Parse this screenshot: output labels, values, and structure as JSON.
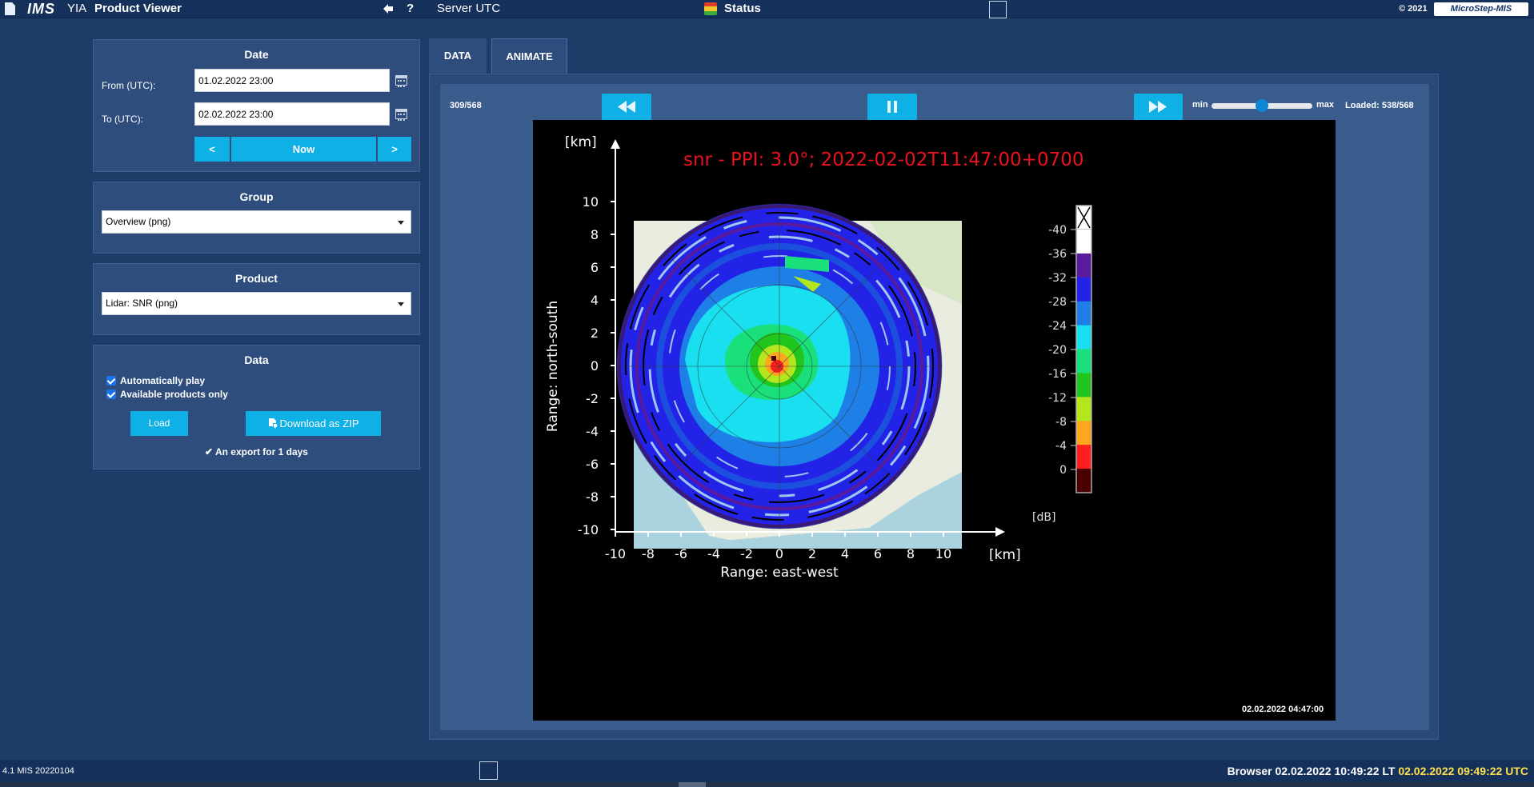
{
  "topbar": {
    "logo": "IMS",
    "ims_sub": "YIA",
    "title": "Product Viewer",
    "help": "?",
    "server_label": "Server UTC",
    "status_label": "Status",
    "copyright": "© 2021",
    "brand": "MicroStep-MIS"
  },
  "date_panel": {
    "title": "Date",
    "from_label": "From (UTC):",
    "from_value": "01.02.2022 23:00",
    "to_label": "To (UTC):",
    "to_value": "02.02.2022 23:00",
    "prev_label": "<",
    "now_label": "Now",
    "next_label": ">"
  },
  "group_panel": {
    "title": "Group",
    "selected": "Overview (png)"
  },
  "product_panel": {
    "title": "Product",
    "selected": "Lidar: SNR (png)"
  },
  "data_panel": {
    "title": "Data",
    "auto_play_label": "Automatically play",
    "available_only_label": "Available products only",
    "load_label": "Load",
    "download_label": "Download as ZIP",
    "export_note": "An export for 1 days"
  },
  "tabs": [
    {
      "label": "DATA",
      "active": false
    },
    {
      "label": "ANIMATE",
      "active": true
    }
  ],
  "animate": {
    "frame_counter": "309/568",
    "slider_min_label": "min",
    "slider_max_label": "max",
    "slider_level": 0.5,
    "loaded": "Loaded: 538/568",
    "product_timestamp": "02.02.2022 04:47:00"
  },
  "plot": {
    "title": "snr - PPI: 3.0°; 2022-02-02T11:47:00+0700",
    "x_label": "Range: east-west",
    "y_label": "Range: north-south",
    "x_unit": "[km]",
    "y_unit": "[km]",
    "x_ticks": [
      "-10",
      "-8",
      "-6",
      "-4",
      "-2",
      "0",
      "2",
      "4",
      "6",
      "8",
      "10"
    ],
    "y_ticks": [
      "10",
      "8",
      "6",
      "4",
      "2",
      "0",
      "-2",
      "-4",
      "-6",
      "-8",
      "-10"
    ],
    "colorbar_unit": "[dB]",
    "colorbar_ticks": [
      "-40",
      "-36",
      "-32",
      "-28",
      "-24",
      "-20",
      "-16",
      "-12",
      "-8",
      "-4",
      "0"
    ],
    "colorbar_colors": [
      "#ffffff",
      "#5b1a9e",
      "#2323e8",
      "#1e7fe6",
      "#19dff0",
      "#19e07a",
      "#22c41e",
      "#b4e61e",
      "#ffa51e",
      "#ff1e1e",
      "#4a0000"
    ]
  },
  "bottombar": {
    "version": "4.1 MIS 20220104",
    "browser_label": "Browser",
    "local_time": "02.02.2022 10:49:22 LT",
    "utc_time": "02.02.2022 09:49:22 UTC"
  }
}
